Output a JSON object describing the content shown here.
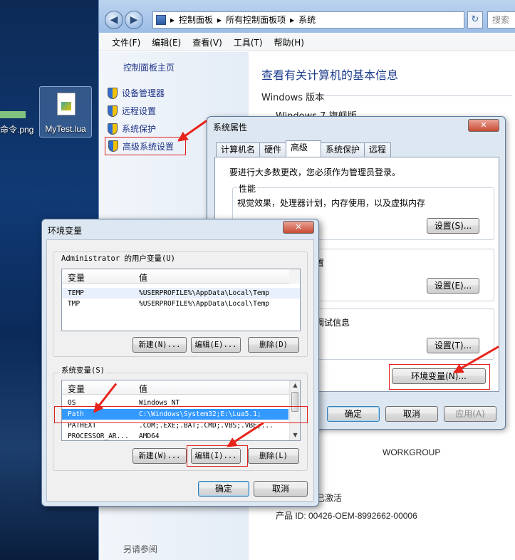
{
  "desktop": {
    "left_label": "命令.png",
    "icon_label": "MyTest.lua"
  },
  "explorer": {
    "breadcrumb": [
      "控制面板",
      "所有控制面板项",
      "系统"
    ],
    "search_placeholder": "搜索",
    "menu": [
      "文件(F)",
      "编辑(E)",
      "查看(V)",
      "工具(T)",
      "帮助(H)"
    ],
    "left_home": "控制面板主页",
    "left_items": [
      "设备管理器",
      "远程设置",
      "系统保护",
      "高级系统设置"
    ],
    "heading": "查看有关计算机的基本信息",
    "windows_version_label": "Windows 版本",
    "windows_edition": "Windows 7 旗舰版",
    "workgroup": "WORKGROUP",
    "activated": "已激活",
    "product_id": "产品 ID: 00426-OEM-8992662-00006",
    "see_also": "另请参阅"
  },
  "system_properties": {
    "title": "系统属性",
    "tabs": [
      "计算机名",
      "硬件",
      "高级",
      "系统保护",
      "远程"
    ],
    "active_tab": "高级",
    "admin_msg": "要进行大多数更改，您必须作为管理员登录。",
    "performance_label": "性能",
    "performance_desc": "视觉效果，处理器计划，内存使用，以及虚拟内存",
    "settings_s": "设置(S)...",
    "profile_partial": "置",
    "settings_e": "设置(E)...",
    "debug_partial": "调试信息",
    "settings_t": "设置(T)...",
    "env_button": "环境变量(N)...",
    "ok": "确定",
    "cancel": "取消",
    "apply": "应用(A)"
  },
  "env_vars": {
    "title": "环境变量",
    "user_group": "Administrator 的用户变量(U)",
    "col_var": "变量",
    "col_val": "值",
    "user_vars": [
      {
        "name": "TEMP",
        "value": "%USERPROFILE%\\AppData\\Local\\Temp"
      },
      {
        "name": "TMP",
        "value": "%USERPROFILE%\\AppData\\Local\\Temp"
      }
    ],
    "user_new": "新建(N)...",
    "user_edit": "编辑(E)...",
    "user_delete": "删除(D)",
    "system_group": "系统变量(S)",
    "system_vars": [
      {
        "name": "OS",
        "value": "Windows_NT"
      },
      {
        "name": "Path",
        "value": "C:\\Windows\\System32;E:\\Lua5.1;"
      },
      {
        "name": "PATHEXT",
        "value": ".COM;.EXE;.BAT;.CMD;.VBS;.VBE;..."
      },
      {
        "name": "PROCESSOR_AR...",
        "value": "AMD64"
      }
    ],
    "selected_var": "Path",
    "sys_new": "新建(W)...",
    "sys_edit": "编辑(I)...",
    "sys_delete": "删除(L)",
    "ok": "确定",
    "cancel": "取消"
  },
  "colors": {
    "annotation_red": "#e8231a",
    "selection_blue": "#3399ff",
    "link_blue": "#1e3287"
  }
}
